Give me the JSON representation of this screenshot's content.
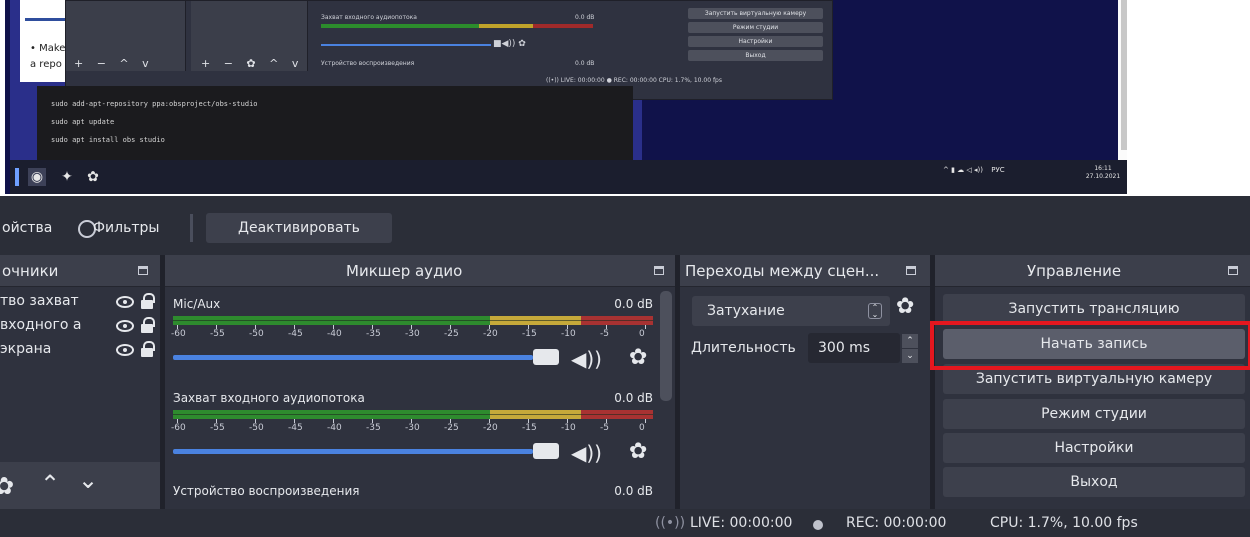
{
  "preview": {
    "doc_line1": "• Make",
    "doc_line2": "a repo",
    "mini_toolbar_a": "+ − ^ v",
    "mini_toolbar_b": "+ − ✿ ^ v",
    "mini_mixer": {
      "ch1": "Захват входного аудиопотока",
      "ch1_db": "0.0 dB",
      "ch2": "Устройство воспроизведения",
      "ch2_db": "0.0 dB"
    },
    "mini_controls": [
      "Запустить виртуальную камеру",
      "Режим студии",
      "Настройки",
      "Выход"
    ],
    "mini_status": "((•)) LIVE: 00:00:00   ●   REC: 00:00:00      CPU: 1.7%, 10.00 fps",
    "terminal": [
      "sudo add-apt-repository ppa:obsproject/obs-studio",
      "sudo apt update",
      "sudo apt install obs studio"
    ],
    "tray": {
      "lang": "РУС",
      "time": "16:11",
      "date": "27.10.2021"
    }
  },
  "context_bar": {
    "properties": "ойства",
    "filters": "Фильтры",
    "deactivate": "Деактивировать"
  },
  "sources": {
    "title": "очники",
    "items": [
      {
        "name": "тво захват"
      },
      {
        "name": "входного а"
      },
      {
        "name": "экрана"
      }
    ]
  },
  "mixer": {
    "title": "Микшер аудио",
    "channels": [
      {
        "name": "Mic/Aux",
        "db": "0.0 dB",
        "volume_fraction": 1.0
      },
      {
        "name": "Захват входного аудиопотока",
        "db": "0.0 dB",
        "volume_fraction": 1.0
      },
      {
        "name": "Устройство воспроизведения",
        "db": "0.0 dB"
      }
    ],
    "ticks": [
      "-60",
      "-55",
      "-50",
      "-45",
      "-40",
      "-35",
      "-30",
      "-25",
      "-20",
      "-15",
      "-10",
      "-5",
      "0"
    ]
  },
  "transitions": {
    "title": "Переходы между сцен...",
    "selected": "Затухание",
    "duration_label": "Длительность",
    "duration_value": "300 ms"
  },
  "controls": {
    "title": "Управление",
    "buttons": [
      "Запустить трансляцию",
      "Начать запись",
      "Запустить виртуальную камеру",
      "Режим студии",
      "Настройки",
      "Выход"
    ],
    "highlighted_color": "#e4171f"
  },
  "status": {
    "live": "LIVE: 00:00:00",
    "rec": "REC: 00:00:00",
    "cpu": "CPU: 1.7%, 10.00 fps"
  }
}
